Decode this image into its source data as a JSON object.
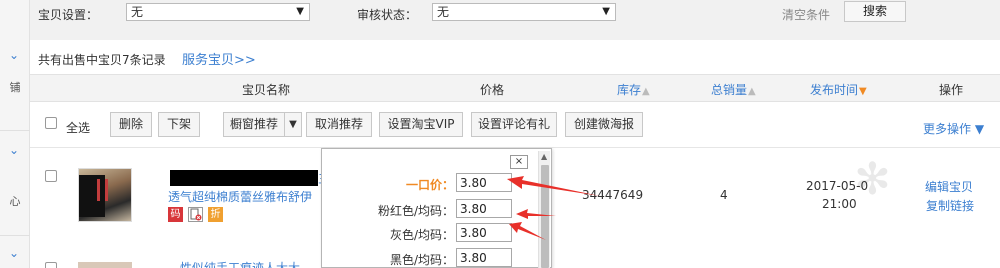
{
  "sidebar": {
    "label_1": "铺",
    "label_2": "心"
  },
  "filter": {
    "item_setting_label": "宝贝设置：",
    "item_setting_value": "无",
    "review_status_label": "审核状态：",
    "review_status_value": "无",
    "clear_label": "清空条件",
    "search_label": "搜索"
  },
  "summary": {
    "count_text": "共有出售中宝贝7条记录",
    "service_link": "服务宝贝>>"
  },
  "table_header": {
    "name": "宝贝名称",
    "price": "价格",
    "stock": "库存",
    "total_sales": "总销量",
    "publish_time": "发布时间",
    "operation": "操作"
  },
  "toolbar": {
    "select_all": "全选",
    "buttons": [
      "删除",
      "下架",
      "橱窗推荐",
      "取消推荐",
      "设置淘宝VIP",
      "设置评论有礼",
      "创建微海报"
    ],
    "more_ops": "更多操作"
  },
  "product": {
    "title_tail": "三",
    "title_line2": "透气超纯棉质蕾丝雅布舒伊",
    "badges": [
      "码",
      "折"
    ],
    "id_number": "34447649",
    "total_sales": "4",
    "date": "2017-05-0",
    "time": "21:00",
    "edit_link": "编辑宝贝",
    "copy_link": "复制链接"
  },
  "next_product": {
    "title_partial": "…性似纯手工痕迹人大大"
  },
  "price_popup": {
    "close": "×",
    "rows": [
      {
        "label": "一口价：",
        "value": "3.80"
      },
      {
        "label": "粉红色/均码：",
        "value": "3.80"
      },
      {
        "label": "灰色/均码：",
        "value": "3.80"
      },
      {
        "label": "黑色/均码：",
        "value": "3.80"
      }
    ]
  },
  "colors": {
    "link_blue": "#3c7fd0",
    "price_orange": "#f08a24",
    "annotation_red": "#e8302a"
  }
}
